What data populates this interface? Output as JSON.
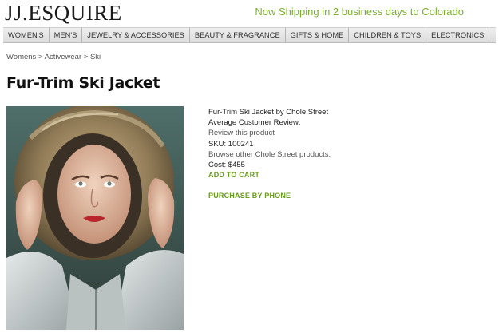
{
  "header": {
    "logo": "JJ.ESQUIRE",
    "shipping_notice": "Now Shipping in 2 business days to Colorado"
  },
  "nav": {
    "items": [
      "WOMEN'S",
      "MEN'S",
      "JEWELRY & ACCESSORIES",
      "BEAUTY & FRAGRANCE",
      "GIFTS & HOME",
      "CHILDREN & TOYS",
      "ELECTRONICS"
    ]
  },
  "breadcrumb": {
    "items": [
      "Womens",
      "Activewear",
      "Ski"
    ],
    "separator": ">"
  },
  "product": {
    "title": "Fur-Trim Ski Jacket",
    "name_line": "Fur-Trim Ski Jacket by Chole Street",
    "review_label": "Average Customer Review:",
    "review_link": "Review this product",
    "sku": "SKU: 100241",
    "browse_link": "Browse other Chole Street products.",
    "cost": "Cost: $455",
    "add_to_cart": "ADD TO CART",
    "purchase_by_phone": "PURCHASE BY PHONE"
  },
  "colors": {
    "accent_green": "#6a9a1f",
    "shipping_green": "#7cae2f"
  }
}
